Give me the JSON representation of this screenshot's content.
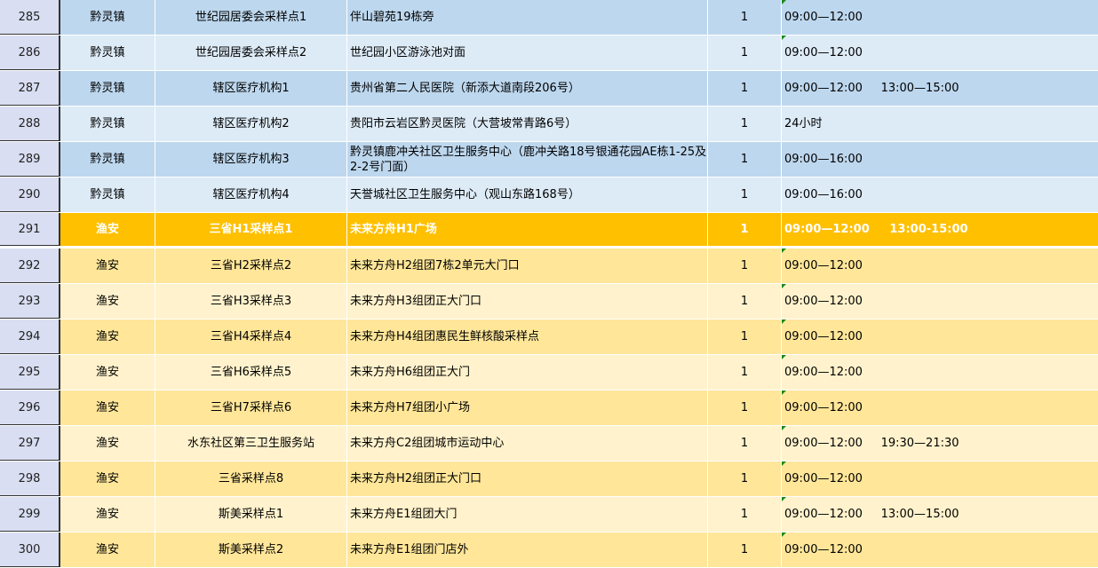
{
  "rows": [
    {
      "num": "285",
      "town": "黔灵镇",
      "site": "世纪园居委会采样点1",
      "address": "伴山碧苑19栋旁",
      "count": "1",
      "hours": "09:00—12:00",
      "style": "blue-d",
      "flag": true
    },
    {
      "num": "286",
      "town": "黔灵镇",
      "site": "世纪园居委会采样点2",
      "address": "世纪园小区游泳池对面",
      "count": "1",
      "hours": "09:00—12:00",
      "style": "blue-l",
      "flag": true
    },
    {
      "num": "287",
      "town": "黔灵镇",
      "site": "辖区医疗机构1",
      "address": "贵州省第二人民医院（新添大道南段206号）",
      "count": "1",
      "hours": "09:00—12:00     13:00—15:00",
      "style": "blue-d",
      "flag": false
    },
    {
      "num": "288",
      "town": "黔灵镇",
      "site": "辖区医疗机构2",
      "address": "贵阳市云岩区黔灵医院（大营坡常青路6号）",
      "count": "1",
      "hours": "24小时",
      "style": "blue-l",
      "flag": false
    },
    {
      "num": "289",
      "town": "黔灵镇",
      "site": "辖区医疗机构3",
      "address": "黔灵镇鹿冲关社区卫生服务中心（鹿冲关路18号银通花园AE栋1-25及2-2号门面）",
      "count": "1",
      "hours": "09:00—16:00",
      "style": "blue-d",
      "flag": false
    },
    {
      "num": "290",
      "town": "黔灵镇",
      "site": "辖区医疗机构4",
      "address": "天誉城社区卫生服务中心（观山东路168号）",
      "count": "1",
      "hours": "09:00—16:00",
      "style": "blue-l",
      "flag": false
    },
    {
      "num": "291",
      "town": "渔安",
      "site": "三省H1采样点1",
      "address": "未来方舟H1广场",
      "count": "1",
      "hours": "09:00—12:00     13:00-15:00",
      "style": "orange",
      "flag": false
    },
    {
      "num": "292",
      "town": "渔安",
      "site": "三省H2采样点2",
      "address": "未来方舟H2组团7栋2单元大门口",
      "count": "1",
      "hours": "09:00—12:00",
      "style": "yel-d",
      "flag": true
    },
    {
      "num": "293",
      "town": "渔安",
      "site": "三省H3采样点3",
      "address": "未来方舟H3组团正大门口",
      "count": "1",
      "hours": "09:00—12:00",
      "style": "yel-l",
      "flag": true
    },
    {
      "num": "294",
      "town": "渔安",
      "site": "三省H4采样点4",
      "address": "未来方舟H4组团惠民生鲜核酸采样点",
      "count": "1",
      "hours": "09:00—12:00",
      "style": "yel-d",
      "flag": true
    },
    {
      "num": "295",
      "town": "渔安",
      "site": "三省H6采样点5",
      "address": "未来方舟H6组团正大门",
      "count": "1",
      "hours": "09:00—12:00",
      "style": "yel-l",
      "flag": true
    },
    {
      "num": "296",
      "town": "渔安",
      "site": "三省H7采样点6",
      "address": "未来方舟H7组团小广场",
      "count": "1",
      "hours": "09:00—12:00",
      "style": "yel-d",
      "flag": true
    },
    {
      "num": "297",
      "town": "渔安",
      "site": "水东社区第三卫生服务站",
      "address": "未来方舟C2组团城市运动中心",
      "count": "1",
      "hours": "09:00—12:00     19:30—21:30",
      "style": "yel-l",
      "flag": true
    },
    {
      "num": "298",
      "town": "渔安",
      "site": "三省采样点8",
      "address": "未来方舟H2组团正大门口",
      "count": "1",
      "hours": "09:00—12:00",
      "style": "yel-d",
      "flag": true
    },
    {
      "num": "299",
      "town": "渔安",
      "site": "斯美采样点1",
      "address": "未来方舟E1组团大门",
      "count": "1",
      "hours": "09:00—12:00     13:00—15:00",
      "style": "yel-l",
      "flag": true
    },
    {
      "num": "300",
      "town": "渔安",
      "site": "斯美采样点2",
      "address": "未来方舟E1组团门店外",
      "count": "1",
      "hours": "09:00—12:00",
      "style": "yel-d",
      "flag": true
    }
  ]
}
